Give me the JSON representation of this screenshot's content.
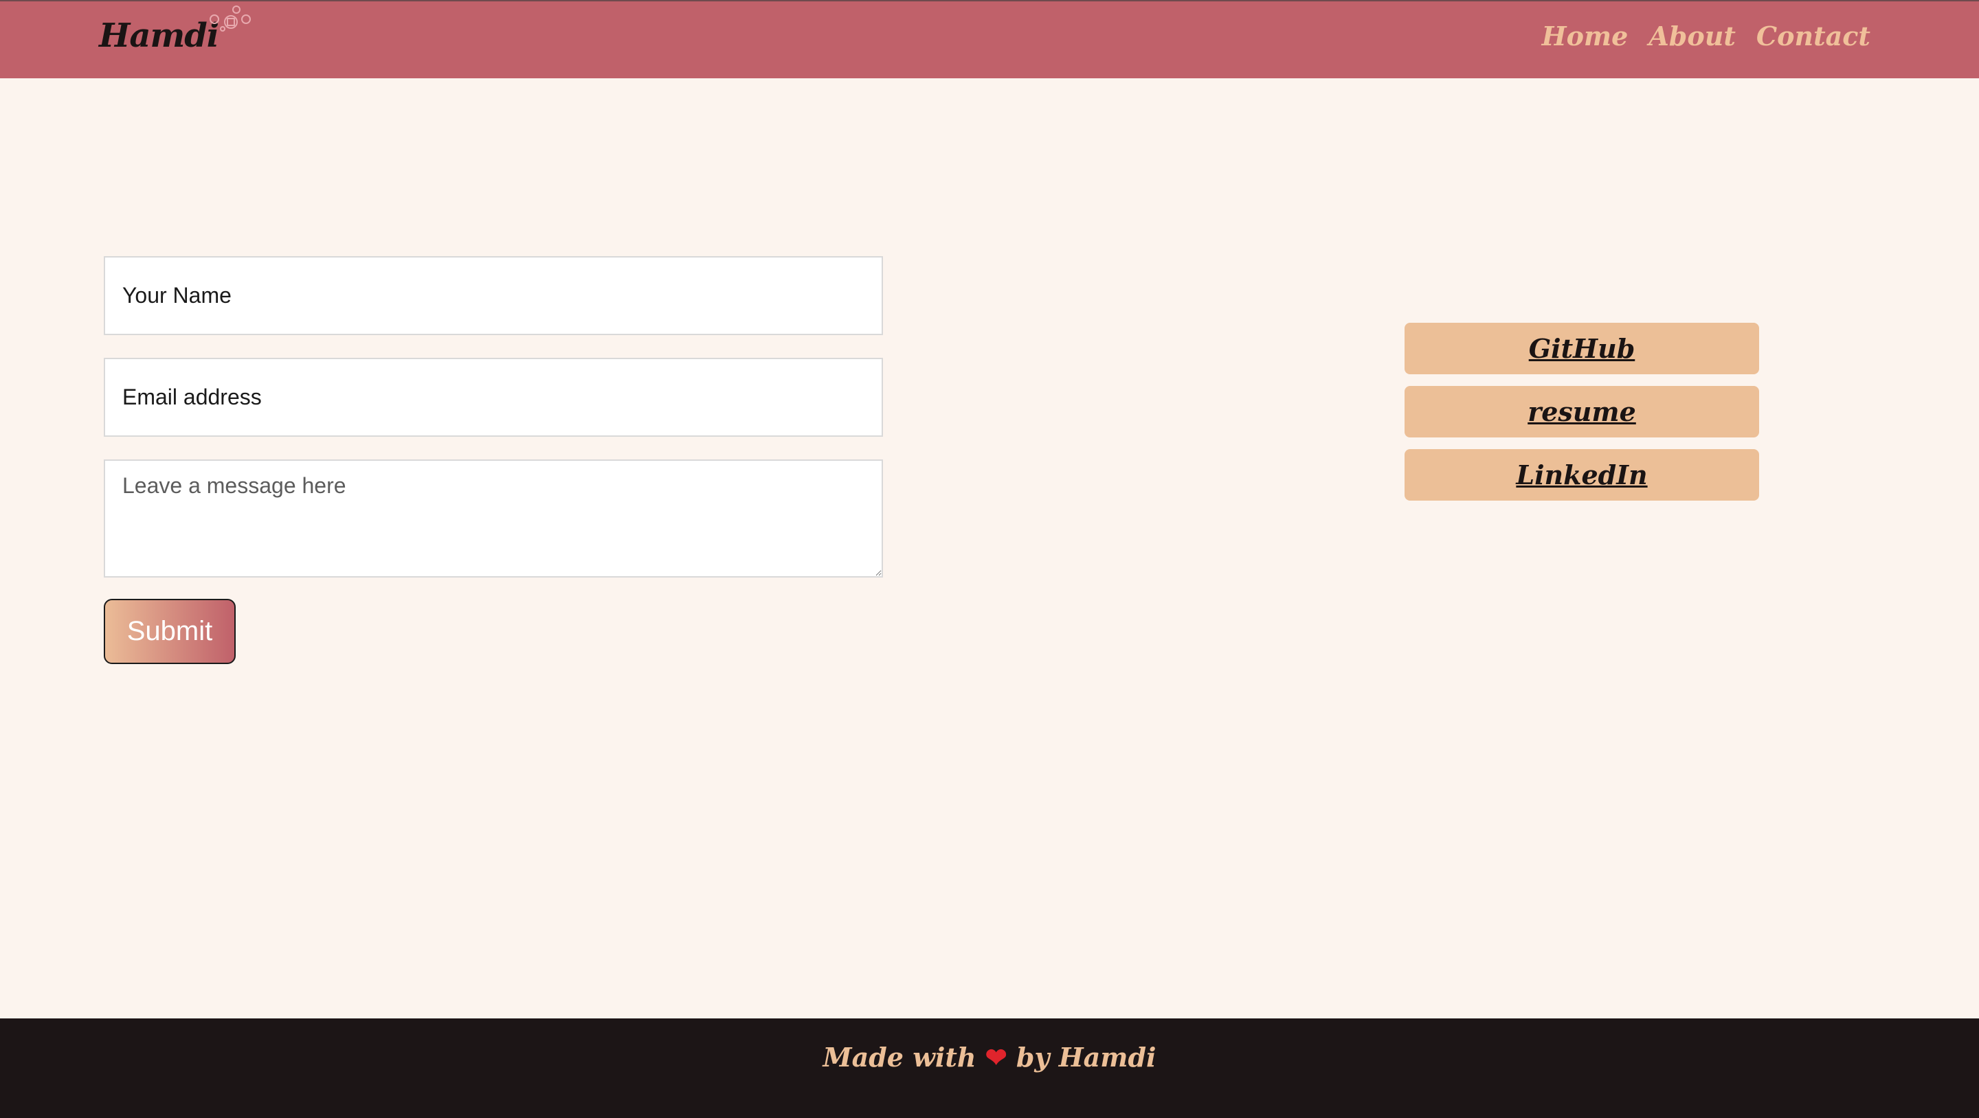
{
  "header": {
    "logo": "Hamdi",
    "nav": [
      "Home",
      "About",
      "Contact"
    ]
  },
  "form": {
    "name_placeholder": "Your Name",
    "email_placeholder": "Email address",
    "message_placeholder": "Leave a message here",
    "submit_label": "Submit"
  },
  "links": {
    "github": "GitHub",
    "resume": "resume",
    "linkedin": "LinkedIn"
  },
  "footer": {
    "prefix": "Made with",
    "heart": "❤",
    "suffix": "by Hamdi"
  },
  "colors": {
    "header_bg": "#c0616a",
    "page_bg": "#fcf4ee",
    "accent_peach": "#ecbf97",
    "footer_bg": "#1c1516"
  }
}
